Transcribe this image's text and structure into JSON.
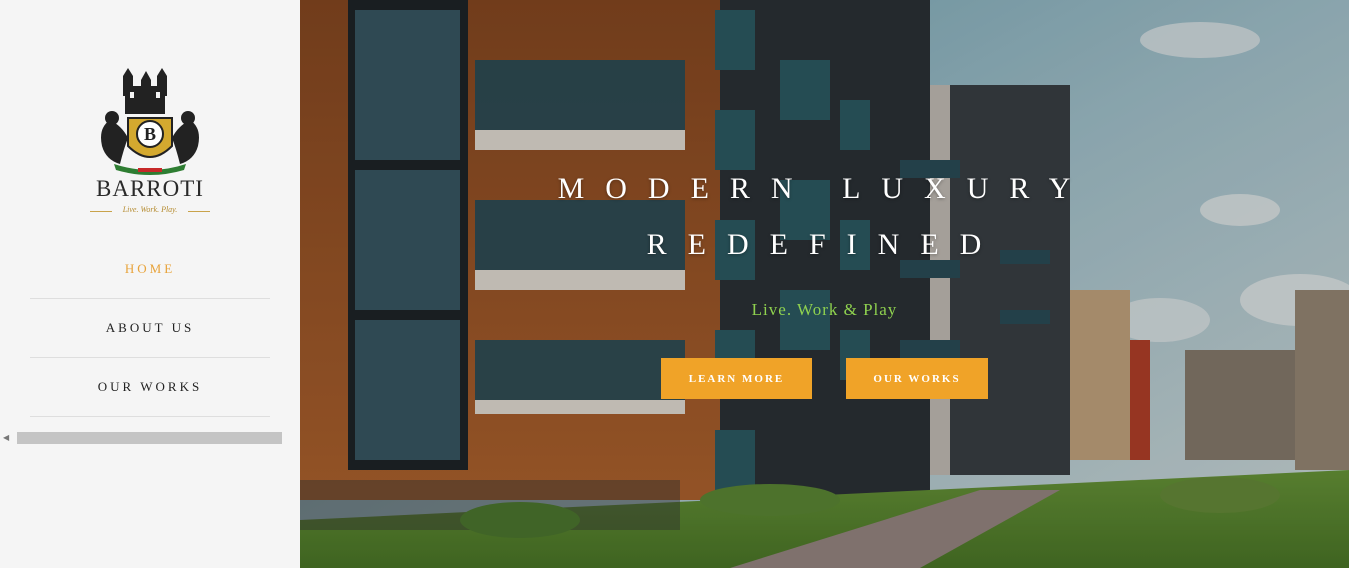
{
  "brand": {
    "name": "BARROTI",
    "tagline": "Live. Work. Play.",
    "logo_letter": "B"
  },
  "nav": {
    "items": [
      {
        "label": "HOME",
        "active": true
      },
      {
        "label": "ABOUT US",
        "active": false
      },
      {
        "label": "OUR WORKS",
        "active": false
      }
    ]
  },
  "hero": {
    "title_line1": "MODERN LUXURY",
    "title_line2": "REDEFINED",
    "subtitle": "Live. Work & Play",
    "learn_more_label": "LEARN MORE",
    "our_works_label": "OUR WORKS"
  },
  "colors": {
    "accent": "#f0a328",
    "nav_active": "#e8a33a",
    "subtitle_green": "#8fd14f",
    "sidebar_bg": "#f5f5f5"
  }
}
